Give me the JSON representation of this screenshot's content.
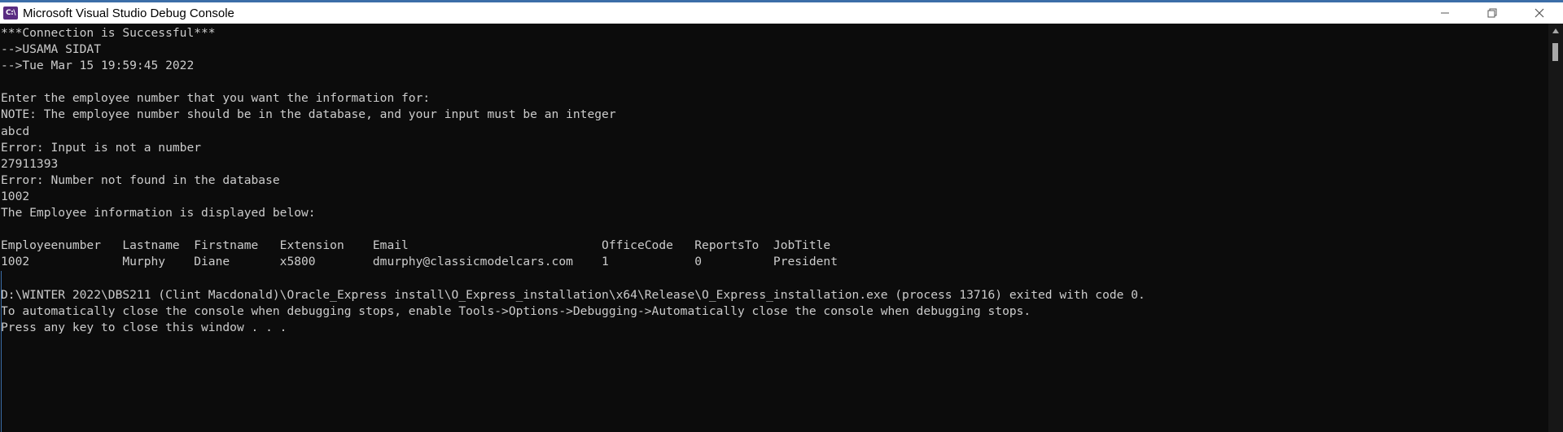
{
  "window": {
    "title": "Microsoft Visual Studio Debug Console",
    "icon_label": "C:\\"
  },
  "controls": {
    "minimize": "minimize-icon",
    "restore": "restore-icon",
    "close": "close-icon"
  },
  "console": {
    "lines": [
      "***Connection is Successful***",
      "-->USAMA SIDAT",
      "-->Tue Mar 15 19:59:45 2022",
      "",
      "Enter the employee number that you want the information for:",
      "NOTE: The employee number should be in the database, and your input must be an integer",
      "abcd",
      "Error: Input is not a number",
      "27911393",
      "Error: Number not found in the database",
      "1002",
      "The Employee information is displayed below:",
      "",
      "Employeenumber   Lastname  Firstname   Extension    Email                           OfficeCode   ReportsTo  JobTitle",
      "1002             Murphy    Diane       x5800        dmurphy@classicmodelcars.com    1            0          President",
      "",
      "D:\\WINTER 2022\\DBS211 (Clint Macdonald)\\Oracle_Express install\\O_Express_installation\\x64\\Release\\O_Express_installation.exe (process 13716) exited with code 0.",
      "To automatically close the console when debugging stops, enable Tools->Options->Debugging->Automatically close the console when debugging stops.",
      "Press any key to close this window . . ."
    ]
  },
  "colors": {
    "background": "#0c0c0c",
    "text": "#cccccc",
    "titlebar": "#ffffff",
    "accent": "#3c6ea8"
  }
}
